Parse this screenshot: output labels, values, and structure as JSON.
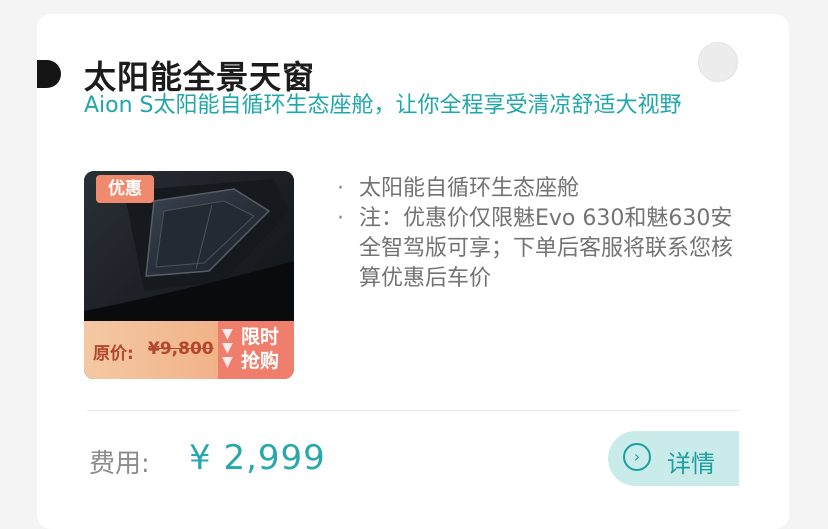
{
  "product": {
    "title": "太阳能全景天窗",
    "subtitle": "Aion S太阳能自循环生态座舱，让你全程享受清凉舒适大视野"
  },
  "thumbnail": {
    "promo_badge": "优惠",
    "original_price_label": "原价:",
    "original_price": "¥9,800",
    "flash_sale_label": "限时抢购"
  },
  "features": [
    "太阳能自循环生态座舱",
    "注：优惠价仅限魅Evo 630和魅630安全智驾版可享；下单后客服将联系您核算优惠后车价"
  ],
  "footer": {
    "fee_label": "费用:",
    "fee_amount": "¥ 2,999",
    "detail_button_label": "详情"
  },
  "colors": {
    "accent": "#27a8aa",
    "detail_button_bg": "#c9eceb",
    "promo": "#f08a6e"
  },
  "icons": [
    "select-circle-icon",
    "chevron-right-circle-icon"
  ]
}
